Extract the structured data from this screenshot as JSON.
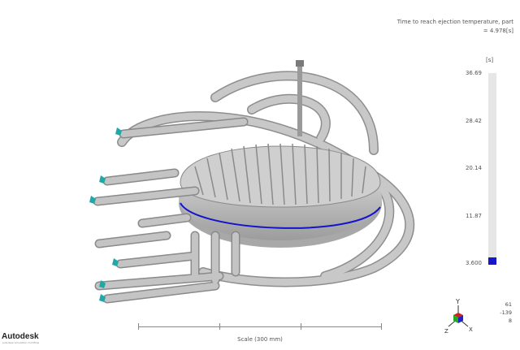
{
  "result": {
    "title": "Time to reach ejection temperature, part",
    "value": "= 4.978[s]"
  },
  "legend": {
    "unit": "[s]",
    "ticks": [
      "36.69",
      "28.42",
      "20.14",
      "11.87",
      "3.600"
    ],
    "fill_fraction": 0.04,
    "fill_color": "#1616d0",
    "bar_color": "#e6e6e6"
  },
  "scale": {
    "label": "Scale (300 mm)"
  },
  "triad": {
    "y": "Y",
    "x": "X",
    "z": "Z"
  },
  "view_coords": [
    "61",
    "-139",
    "8"
  ],
  "logo": {
    "name": "Autodesk",
    "tagline": "autodesk simulation moldflow"
  },
  "colors": {
    "model_gray": "#c4c4c4",
    "inlet_cyan": "#1fa8a8",
    "accent_blue": "#1414cc"
  }
}
